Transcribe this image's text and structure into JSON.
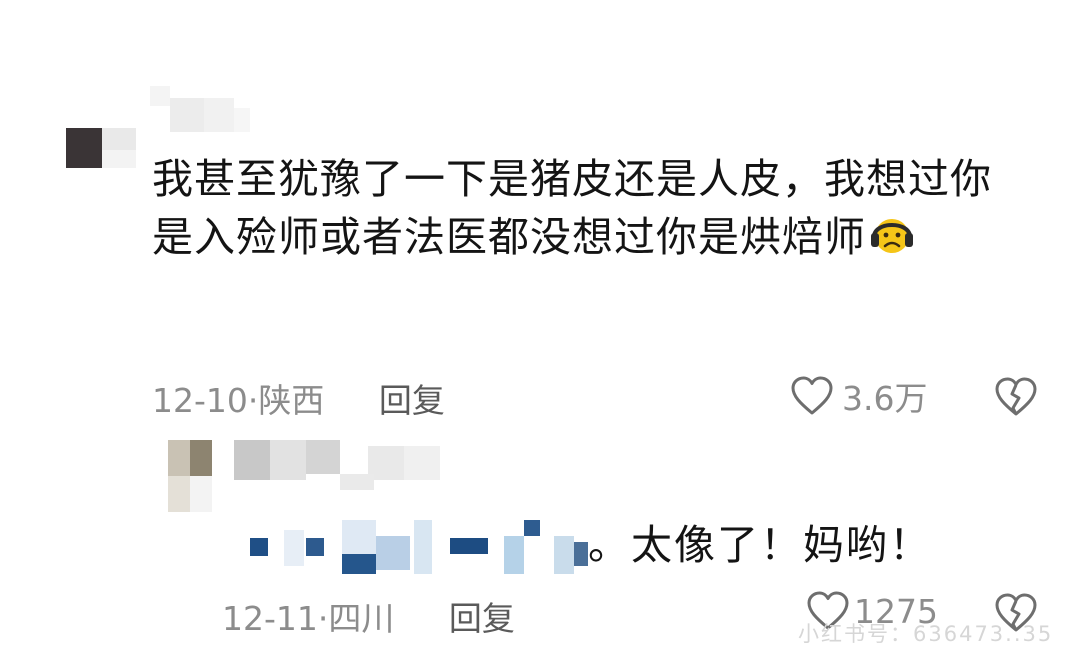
{
  "comments": [
    {
      "text": "我甚至犹豫了一下是猪皮还是人皮，我想过你是入殓师或者法医都没想过你是烘焙师",
      "emoji": "frowning-face-emoji",
      "date": "12-10",
      "location": "陕西",
      "reply_label": "回复",
      "likes": "3.6万"
    },
    {
      "text_visible": "。太像了！妈哟！",
      "date": "12-11",
      "location": "四川",
      "reply_label": "回复",
      "likes": "1275"
    }
  ],
  "separator": "·",
  "watermark": "小红书号：636473..35",
  "icons": {
    "like": "heart-outline-icon",
    "dislike": "broken-heart-icon"
  },
  "colors": {
    "text": "#141414",
    "meta": "#8c8c8c",
    "reply": "#5a5a5a",
    "icon": "#6e6e6e",
    "emoji_face": "#f5c518",
    "emoji_headphones": "#2b2b2b",
    "background": "#ffffff"
  }
}
